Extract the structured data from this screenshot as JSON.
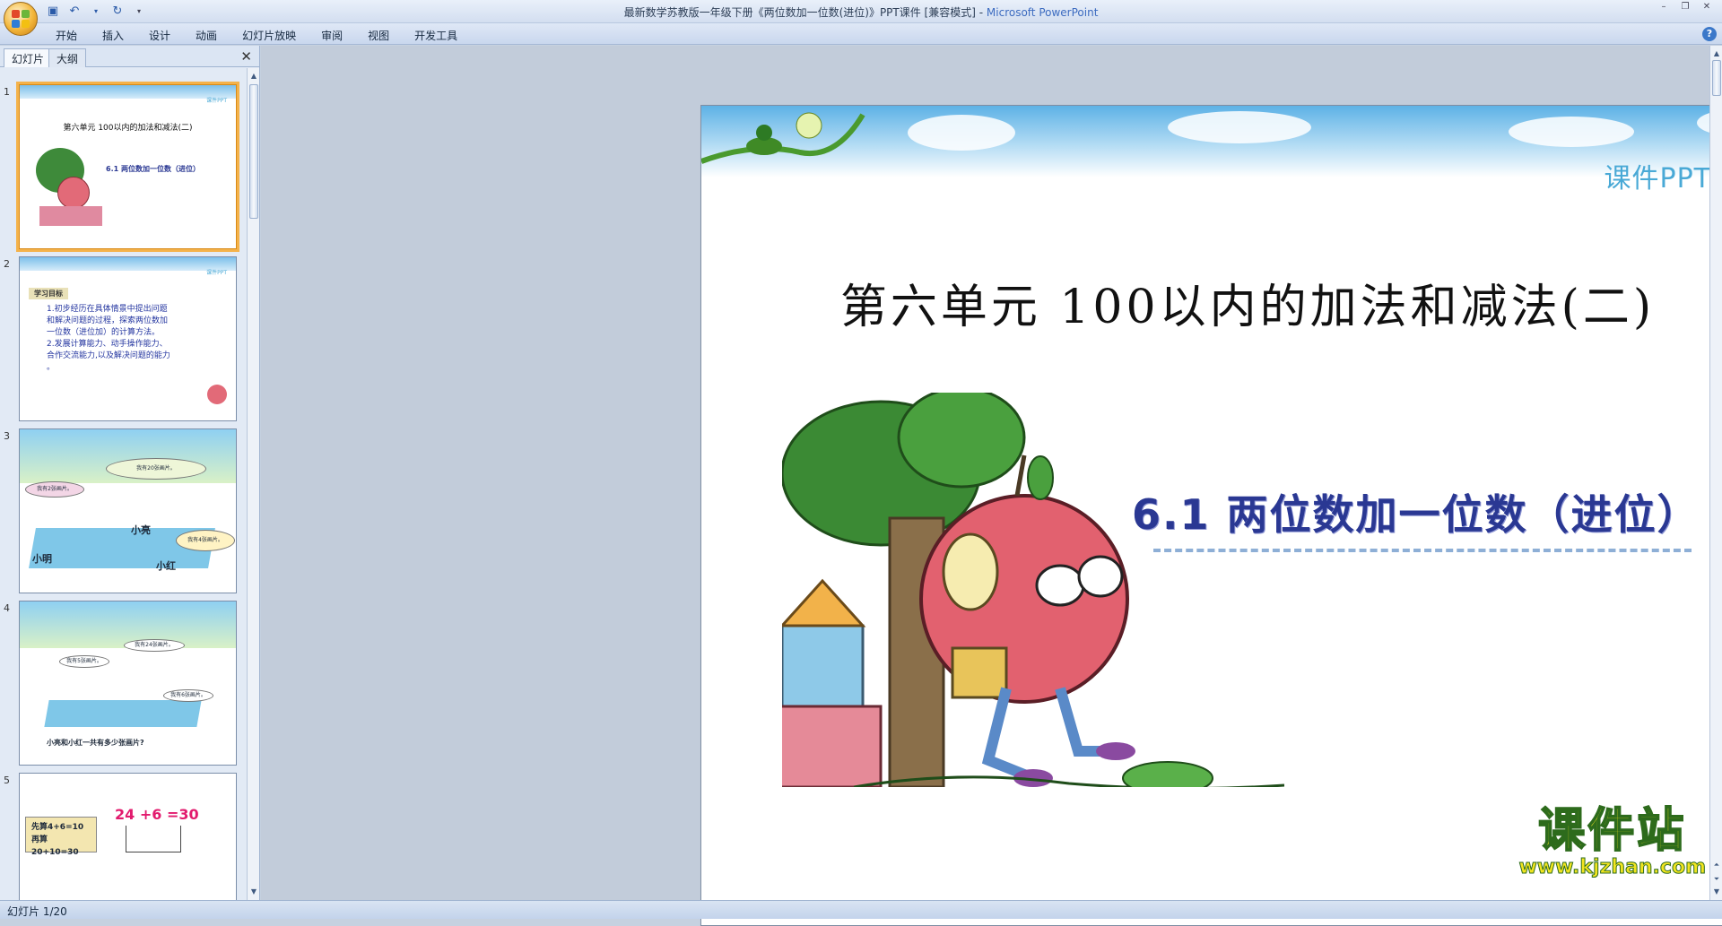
{
  "window": {
    "title": "最新数学苏教版一年级下册《两位数加一位数(进位)》PPT课件 [兼容模式]",
    "app_name": "Microsoft PowerPoint",
    "separator": " - "
  },
  "ribbon": {
    "tabs": [
      "开始",
      "插入",
      "设计",
      "动画",
      "幻灯片放映",
      "审阅",
      "视图",
      "开发工具"
    ]
  },
  "left_pane": {
    "tab_slides": "幻灯片",
    "tab_outline": "大纲",
    "close_glyph": "✕",
    "thumbnails": [
      {
        "num": "1",
        "title": "第六单元 100以内的加法和减法(二)",
        "subtitle": "6.1 两位数加一位数（进位）",
        "tag": "课件PPT"
      },
      {
        "num": "2",
        "heading": "学习目标",
        "lines": [
          "1.初步经历在具体情景中提出问题",
          "和解决问题的过程，探索两位数加",
          "一位数（进位加）的计算方法。",
          "2.发展计算能力、动手操作能力、",
          "合作交流能力,以及解决问题的能力",
          "。"
        ],
        "tag": "课件PPT"
      },
      {
        "num": "3",
        "bubbles": [
          "我有20张画片。",
          "我有2张画片。",
          "我有4张画片。"
        ],
        "names": [
          "小亮",
          "小明",
          "小红"
        ]
      },
      {
        "num": "4",
        "bubbles": [
          "我有24张画片。",
          "我有5张画片。",
          "我有6张画片。"
        ],
        "question": "小亮和小红一共有多少张画片?"
      },
      {
        "num": "5",
        "equation": [
          "24",
          "+6",
          "=30"
        ],
        "steps": [
          "先算4+6=10",
          "再算20+10=30"
        ]
      }
    ]
  },
  "slide": {
    "tag": "课件PPT",
    "title": "第六单元 100以内的加法和减法(二)",
    "subtitle": "6.1 两位数加一位数（进位）"
  },
  "watermark": {
    "brand": "课件站",
    "url": "www.kjzhan.com"
  },
  "status_bar": {
    "slide_indicator": "幻灯片 1/20"
  }
}
